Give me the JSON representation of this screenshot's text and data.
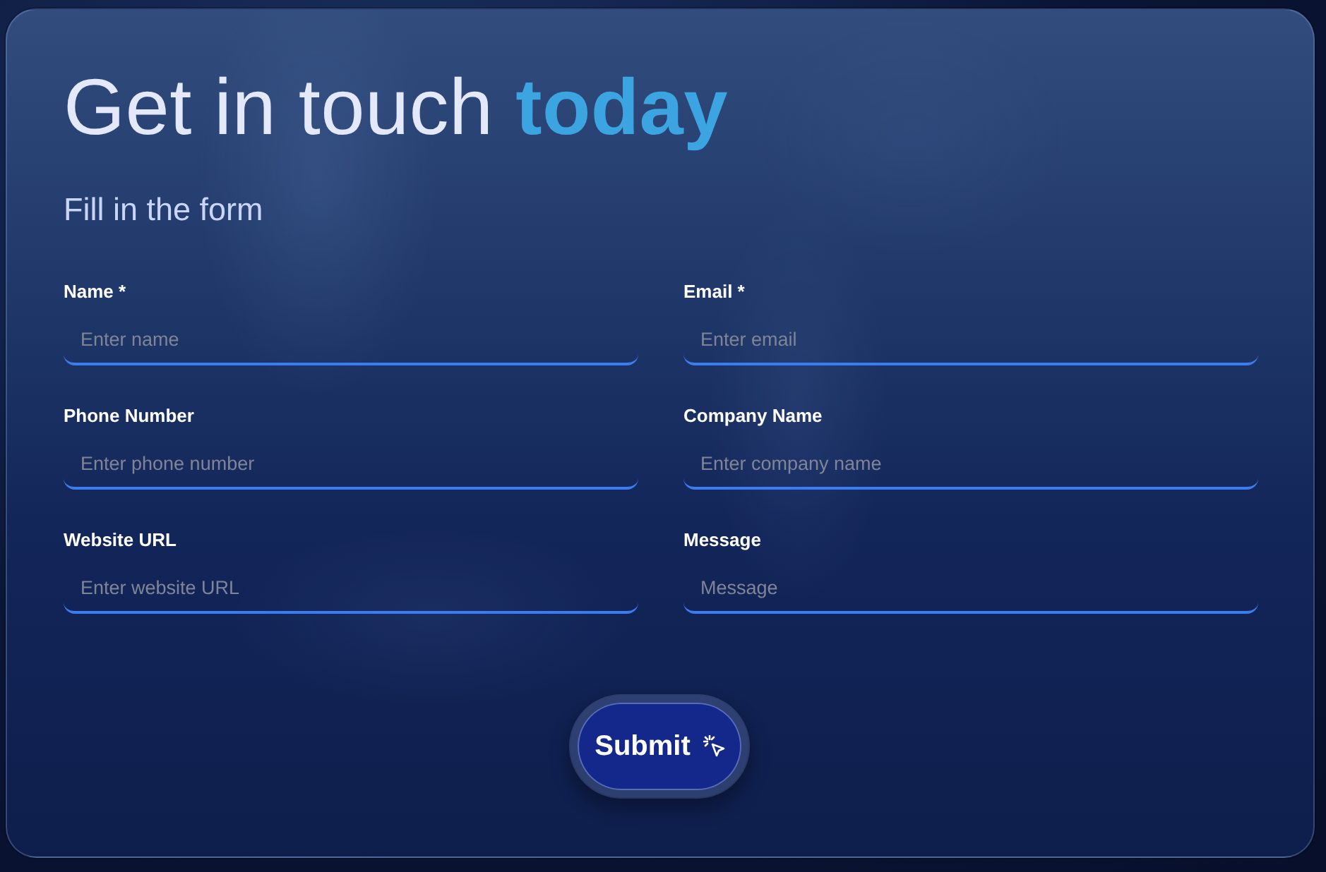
{
  "header": {
    "title": "Get in touch **today**",
    "subtitle": "Fill in the form"
  },
  "fields": [
    {
      "label": "Name *",
      "placeholder": "Enter name"
    },
    {
      "label": "Email *",
      "placeholder": "Enter email"
    },
    {
      "label": "Phone Number",
      "placeholder": "Enter phone number"
    },
    {
      "label": "Company Name",
      "placeholder": "Enter company name"
    },
    {
      "label": "Website URL",
      "placeholder": "Enter website URL"
    },
    {
      "label": "Message",
      "placeholder": "Message"
    }
  ],
  "submit": {
    "label": "Submit"
  }
}
